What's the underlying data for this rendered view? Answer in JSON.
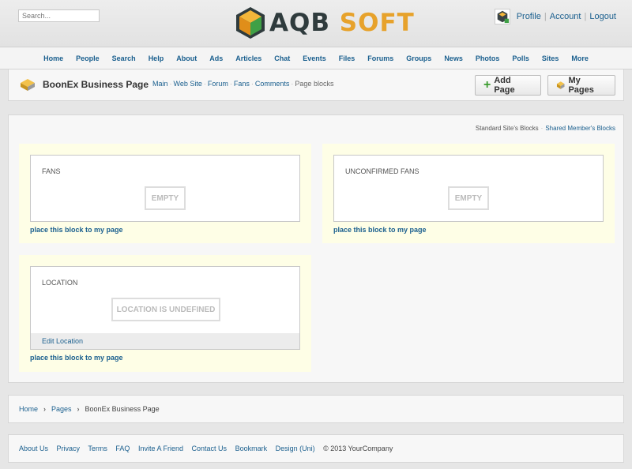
{
  "header": {
    "search_placeholder": "Search...",
    "logo_left": "AQB",
    "logo_right": "SOFT",
    "user_links": [
      "Profile",
      "Account",
      "Logout"
    ]
  },
  "nav": [
    "Home",
    "People",
    "Search",
    "Help",
    "About",
    "Ads",
    "Articles",
    "Chat",
    "Events",
    "Files",
    "Forums",
    "Groups",
    "News",
    "Photos",
    "Polls",
    "Sites",
    "More"
  ],
  "page": {
    "title": "BoonEx Business Page",
    "subnav": [
      "Main",
      "Web Site",
      "Forum",
      "Fans",
      "Comments",
      "Page blocks"
    ],
    "add_page": "Add Page",
    "my_pages": "My Pages"
  },
  "blocklinks": [
    "Standard Site's Blocks",
    "Shared Member's Blocks"
  ],
  "blocks": {
    "fans": {
      "title": "FANS",
      "empty": "EMPTY",
      "place": "place this block to my page"
    },
    "unconfirmed": {
      "title": "UNCONFIRMED FANS",
      "empty": "EMPTY",
      "place": "place this block to my page"
    },
    "location": {
      "title": "LOCATION",
      "empty": "LOCATION IS UNDEFINED",
      "edit": "Edit Location",
      "place": "place this block to my page"
    }
  },
  "breadcrumb": [
    "Home",
    "Pages",
    "BoonEx Business Page"
  ],
  "footer": {
    "links": [
      "About Us",
      "Privacy",
      "Terms",
      "FAQ",
      "Invite A Friend",
      "Contact Us",
      "Bookmark",
      "Design (Uni)"
    ],
    "copyright": "© 2013 YourCompany"
  },
  "colors": {
    "link": "#1a5f8e",
    "logo_accent": "#e7a22b",
    "block_zone": "#fefee6"
  }
}
